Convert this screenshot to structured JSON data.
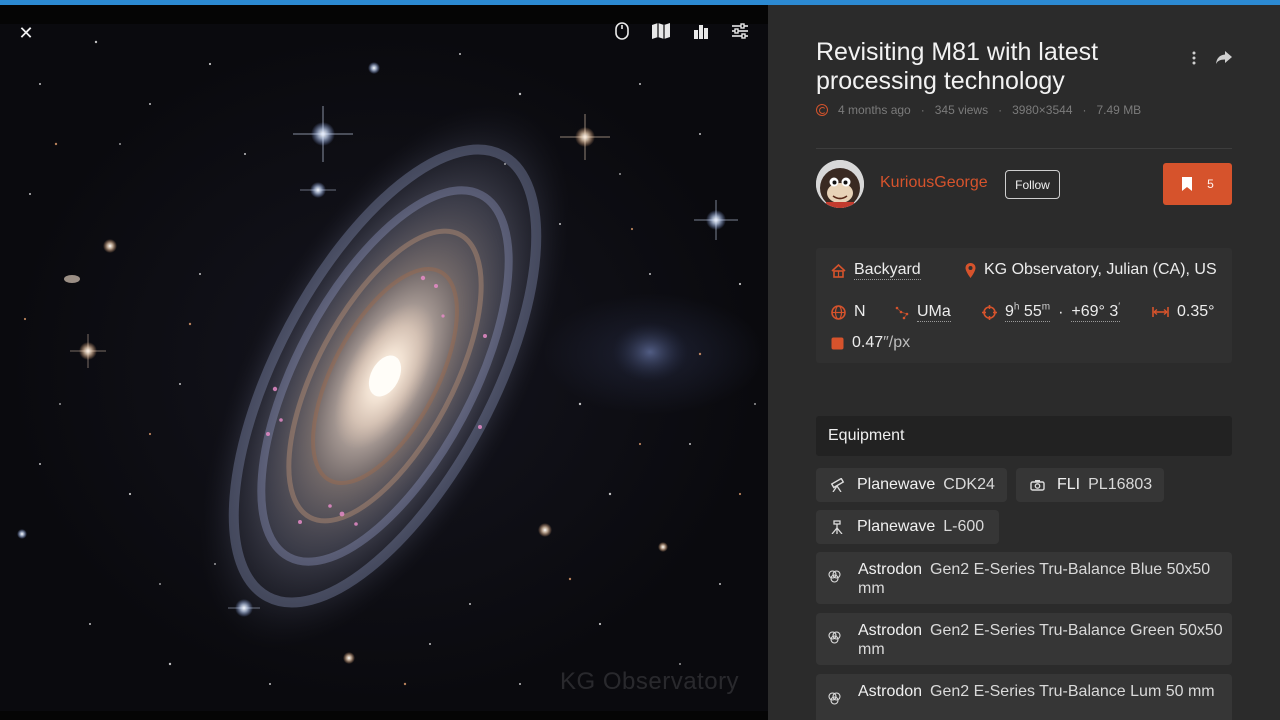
{
  "viewer": {
    "close_label": "✕",
    "watermark": "KG Observatory"
  },
  "photo": {
    "title": "Revisiting M81 with latest processing technology",
    "license_icon": "creative-commons-icon",
    "age": "4 months ago",
    "views": "345 views",
    "resolution": "3980×3544",
    "file_size": "7.49 MB"
  },
  "author": {
    "name": "KuriousGeorge",
    "follow_label": "Follow",
    "bookmark_count": "5"
  },
  "location": {
    "site_type": "Backyard",
    "place": "KG Observatory, Julian (CA), US",
    "hemisphere": "N",
    "constellation": "UMa",
    "ra_h": "9",
    "ra_h_unit": "h",
    "ra_m": "55",
    "ra_m_unit": "m",
    "dec_deg": "+69°",
    "dec_min": "3",
    "dec_min_unit": "′",
    "fov": "0.35°",
    "scale_value": "0.47",
    "scale_unit": "″/px"
  },
  "equipment": {
    "header": "Equipment",
    "items": [
      {
        "brand": "Planewave",
        "model": "CDK24",
        "icon": "telescope-icon"
      },
      {
        "brand": "FLI",
        "model": "PL16803",
        "icon": "camera-icon"
      },
      {
        "brand": "Planewave",
        "model": "L-600",
        "icon": "mount-icon"
      },
      {
        "brand": "Astrodon",
        "model": "Gen2 E-Series Tru-Balance Blue 50x50 mm",
        "icon": "filter-icon"
      },
      {
        "brand": "Astrodon",
        "model": "Gen2 E-Series Tru-Balance Green 50x50 mm",
        "icon": "filter-icon"
      },
      {
        "brand": "Astrodon",
        "model": "Gen2 E-Series Tru-Balance Lum 50 mm",
        "icon": "filter-icon"
      }
    ]
  },
  "colors": {
    "accent": "#d6532c",
    "top_bar": "#2c8ad2",
    "panel_bg": "#2b2b2b"
  }
}
